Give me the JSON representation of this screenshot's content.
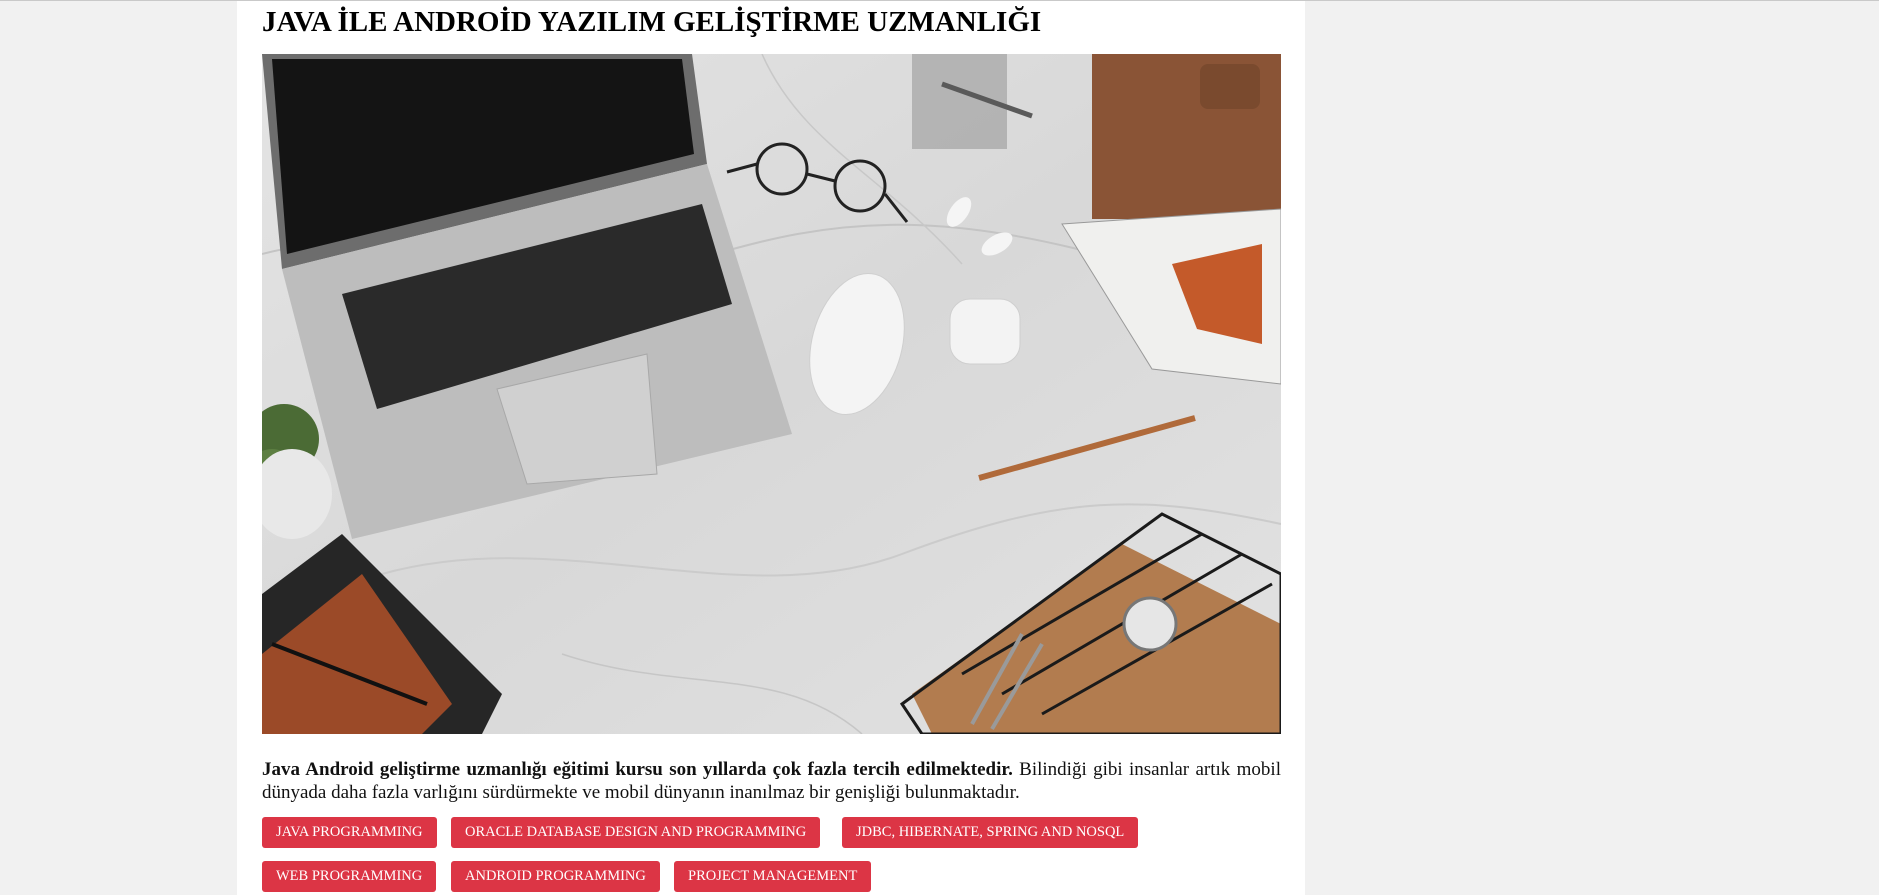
{
  "page": {
    "title": "JAVA İLE ANDROİD YAZILIM GELİŞTİRME UZMANLIĞI",
    "description_bold": "Java Android geliştirme uzmanlığı eğitimi kursu son yıllarda çok fazla tercih edilmektedir.",
    "description_rest": " Bilindiği gibi insanlar artık mobil dünyada daha fazla varlığını sürdürmekte ve mobil dünyanın inanılmaz bir genişliği bulunmaktadır."
  },
  "tags": [
    "JAVA PROGRAMMING",
    "ORACLE DATABASE DESIGN AND PROGRAMMING",
    "JDBC, HIBERNATE, SPRING AND NOSQL",
    "WEB PROGRAMMING",
    "ANDROID PROGRAMMING",
    "PROJECT MANAGEMENT"
  ],
  "colors": {
    "tag_background": "#dc3545",
    "page_background": "#f1f1f1"
  }
}
